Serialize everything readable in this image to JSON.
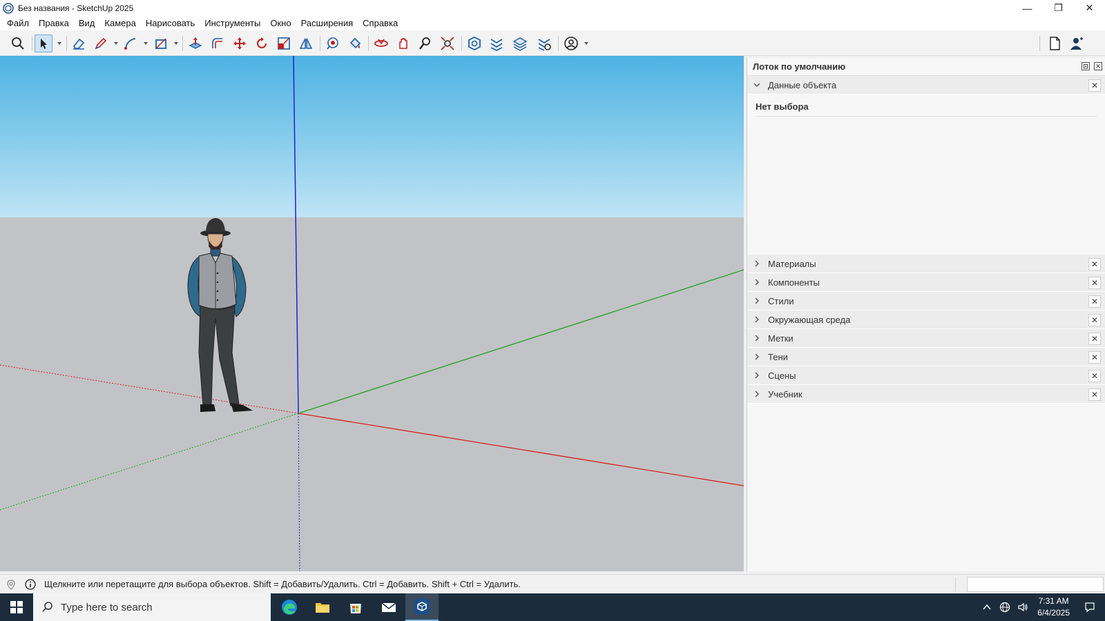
{
  "window": {
    "title": "Без названия - SketchUp 2025",
    "controls": {
      "minimize": "—",
      "restore": "❐",
      "close": "✕"
    }
  },
  "menu": [
    "Файл",
    "Правка",
    "Вид",
    "Камера",
    "Нарисовать",
    "Инструменты",
    "Окно",
    "Расширения",
    "Справка"
  ],
  "toolbar": {
    "tools": [
      "search-icon",
      "select-icon",
      "eraser-icon",
      "pencil-icon",
      "arc-icon",
      "rectangle-icon",
      "push-pull-icon",
      "offset-icon",
      "move-icon",
      "rotate-icon",
      "scale-icon",
      "tape-measure-icon",
      "paint-bucket-icon",
      "orbit-icon",
      "section-icon",
      "pan-icon",
      "zoom-icon",
      "zoom-extents-icon",
      "warehouse-icon",
      "extension-icon",
      "layers-icon",
      "settings-icon",
      "account-icon"
    ],
    "right_tools": [
      "new-document-icon",
      "user-icon"
    ]
  },
  "tray": {
    "title": "Лоток по умолчанию",
    "entity_info": {
      "label": "Данные объекта",
      "status": "Нет выбора"
    },
    "panels": [
      "Материалы",
      "Компоненты",
      "Стили",
      "Окружающая среда",
      "Метки",
      "Тени",
      "Сцены",
      "Учебник"
    ]
  },
  "status": {
    "text": "Щелкните или перетащите для выбора объектов. Shift = Добавить/Удалить. Ctrl = Добавить. Shift + Ctrl = Удалить."
  },
  "taskbar": {
    "search_placeholder": "Type here to search",
    "apps": [
      "edge-icon",
      "file-explorer-icon",
      "store-icon",
      "mail-icon",
      "sketchup-icon"
    ],
    "time": "7:31 AM",
    "date": "6/4/2025"
  },
  "colors": {
    "x_axis": "#d42020",
    "y_axis": "#1fa020",
    "z_axis": "#2020d4",
    "sky_top": "#4db2e3",
    "ground": "#c2c3c6"
  }
}
